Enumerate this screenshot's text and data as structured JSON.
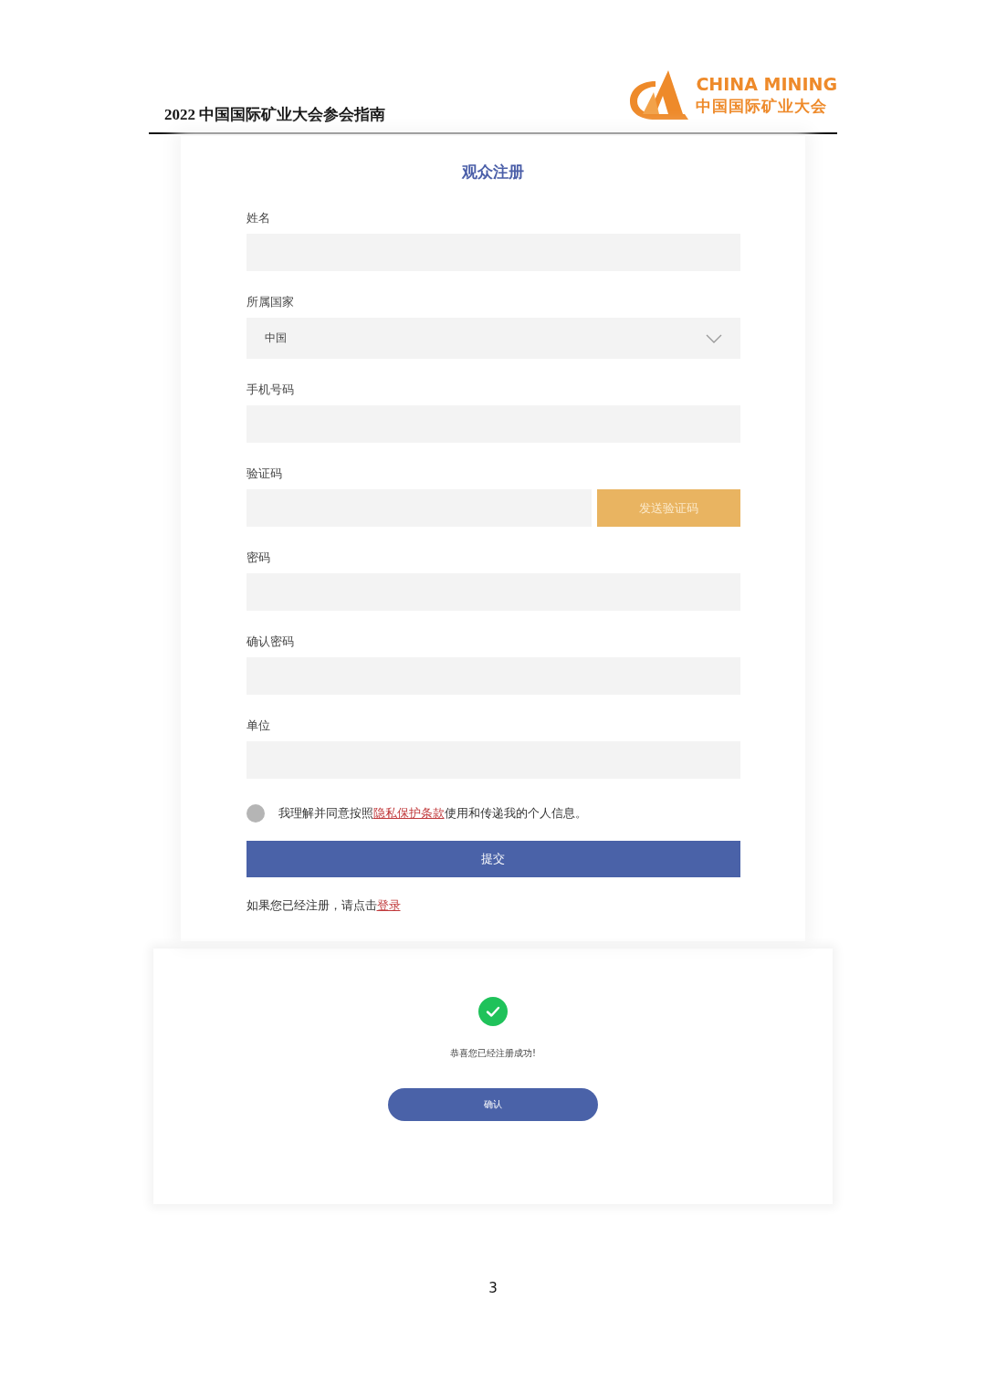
{
  "header": {
    "title": "2022 中国国际矿业大会参会指南",
    "logo_en": "CHINA MINING",
    "logo_cn": "中国国际矿业大会"
  },
  "form": {
    "title": "观众注册",
    "fields": [
      {
        "kind": "text",
        "label": "姓名"
      },
      {
        "kind": "select",
        "label": "所属国家",
        "value": "中国"
      },
      {
        "kind": "text",
        "label": "手机号码"
      },
      {
        "kind": "code",
        "label": "验证码",
        "button": "发送验证码"
      },
      {
        "kind": "text",
        "label": "密码"
      },
      {
        "kind": "text",
        "label": "确认密码"
      },
      {
        "kind": "text",
        "label": "单位"
      }
    ],
    "consent": {
      "checked": false,
      "before": "我理解并同意按照",
      "link": "隐私保护条款",
      "after": "使用和传递我的个人信息。"
    },
    "submit": "提交",
    "login_prompt": {
      "text": "如果您已经注册，请点击",
      "link": "登录"
    }
  },
  "success_dialog": {
    "message": "恭喜您已经注册成功!",
    "button": "确认"
  },
  "page_number": "3"
}
